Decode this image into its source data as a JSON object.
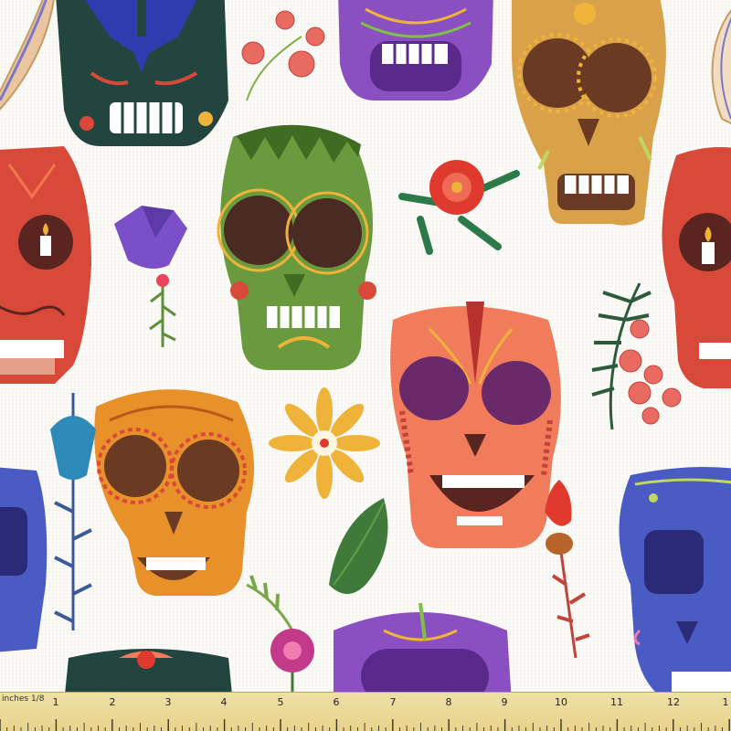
{
  "image": {
    "subject": "Sugar skull (Dia de los Muertos) fabric swatch",
    "background_color": "#fbfaf7"
  },
  "palette": {
    "green": "#6a9a3e",
    "orange": "#e8902a",
    "coral": "#f07c5c",
    "red": "#d9493a",
    "purple": "#8a4fc0",
    "blue": "#4b5bc4",
    "dark_teal": "#23453f",
    "tan": "#d9a24a",
    "eye_dark": "#4a2a22"
  },
  "ruler": {
    "unit_label": "inches 1/8",
    "numbers": [
      "1",
      "2",
      "3",
      "4",
      "5",
      "6",
      "7",
      "8",
      "9",
      "10",
      "11",
      "12",
      "1"
    ],
    "color": "#e8d38c"
  }
}
